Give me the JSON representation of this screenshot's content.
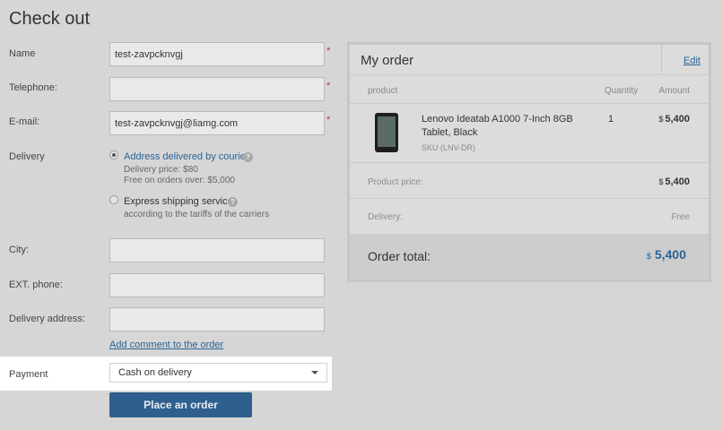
{
  "page": {
    "title": "Check out"
  },
  "form": {
    "name": {
      "label": "Name",
      "value": "test-zavpcknvgj"
    },
    "telephone": {
      "label": "Telephone:",
      "value": ""
    },
    "email": {
      "label": "E-mail:",
      "value": "test-zavpcknvgj@liamg.com"
    },
    "required_mark": "*",
    "delivery": {
      "label": "Delivery",
      "options": [
        {
          "title": "Address delivered by courier",
          "lines": [
            "Delivery price: $80",
            "Free on orders over: $5,000"
          ],
          "selected": true
        },
        {
          "title": "Express shipping service",
          "lines": [
            "according to the tariffs of the carriers"
          ],
          "selected": false
        }
      ],
      "help_glyph": "?"
    },
    "city": {
      "label": "City:",
      "value": ""
    },
    "ext_phone": {
      "label": "EXT. phone:",
      "value": ""
    },
    "delivery_address": {
      "label": "Delivery address:",
      "value": ""
    },
    "add_comment_link": "Add comment to the order",
    "payment": {
      "label": "Payment",
      "selected": "Cash on delivery"
    },
    "submit_label": "Place an order"
  },
  "order": {
    "title": "My order",
    "edit_link": "Edit",
    "columns": {
      "product": "product",
      "quantity": "Quantity",
      "amount": "Amount"
    },
    "item": {
      "name": "Lenovo Ideatab A1000 7-Inch 8GB Tablet, Black",
      "sku": "SKU (LNV-DR)",
      "quantity": "1",
      "currency": "$",
      "amount": "5,400"
    },
    "product_price": {
      "label": "Product price:",
      "currency": "$",
      "value": "5,400"
    },
    "delivery": {
      "label": "Delivery:",
      "value": "Free"
    },
    "total": {
      "label": "Order total:",
      "currency": "$",
      "value": "5,400"
    }
  },
  "colors": {
    "accent": "#2a6496",
    "button": "#2f5f8c",
    "required": "#c0392b"
  }
}
